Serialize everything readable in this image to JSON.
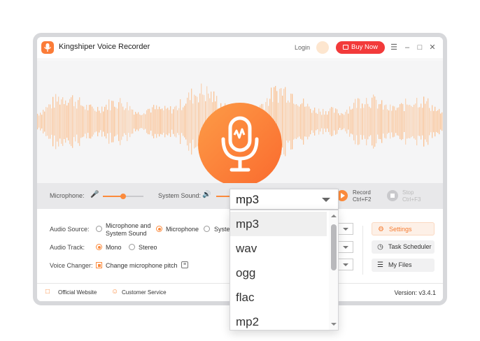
{
  "titlebar": {
    "app_title": "Kingshiper Voice Recorder",
    "login": "Login",
    "buy_now": "Buy Now"
  },
  "controls": {
    "microphone_label": "Microphone:",
    "microphone_level": 0.5,
    "system_sound_label": "System Sound:",
    "record_label": "Record",
    "record_shortcut": "Ctrl+F2",
    "stop_label": "Stop",
    "stop_shortcut": "Ctrl+F3"
  },
  "settings": {
    "audio_source_label": "Audio Source:",
    "audio_source_options": [
      "Microphone and",
      "System Sound",
      "Microphone",
      "System"
    ],
    "audio_track_label": "Audio Track:",
    "audio_track_options": [
      "Mono",
      "Stereo"
    ],
    "voice_changer_label": "Voice Changer:",
    "voice_changer_option": "Change microphone pitch"
  },
  "side_buttons": {
    "settings": "Settings",
    "task_scheduler": "Task Scheduler",
    "my_files": "My Files"
  },
  "footer": {
    "official_website": "Official Website",
    "customer_service": "Customer Service",
    "version": "Version:  v3.4.1"
  },
  "format_dropdown": {
    "selected": "mp3",
    "options": [
      "mp3",
      "wav",
      "ogg",
      "flac",
      "mp2"
    ]
  },
  "colors": {
    "accent": "#fb8a3c",
    "buy_button": "#f23a3a"
  }
}
